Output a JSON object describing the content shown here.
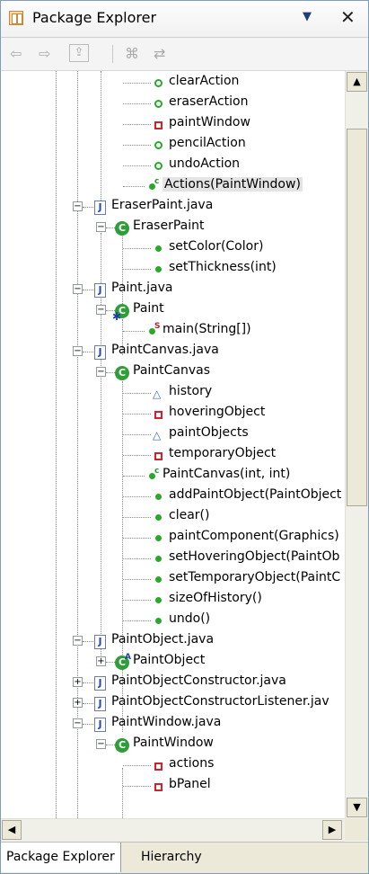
{
  "view": {
    "title": "Package Explorer",
    "menu_glyph": "▼",
    "close_glyph": "✕"
  },
  "toolbar": {
    "back_glyph": "⇦",
    "forward_glyph": "⇨",
    "up_glyph": "⇪",
    "collapse_glyph": "⌘",
    "link_glyph": "⇄"
  },
  "tree": {
    "rows": [
      {
        "label": "clearAction",
        "icon": "field-public-icon"
      },
      {
        "label": "eraserAction",
        "icon": "field-public-icon"
      },
      {
        "label": "paintWindow",
        "icon": "field-private-icon"
      },
      {
        "label": "pencilAction",
        "icon": "field-public-icon"
      },
      {
        "label": "undoAction",
        "icon": "field-public-icon"
      },
      {
        "label": "Actions(PaintWindow)",
        "icon": "constructor-icon",
        "selected": true
      },
      {
        "label": "EraserPaint.java",
        "icon": "java-file-icon"
      },
      {
        "label": "EraserPaint",
        "icon": "class-icon"
      },
      {
        "label": "setColor(Color)",
        "icon": "method-public-icon"
      },
      {
        "label": "setThickness(int)",
        "icon": "method-public-icon"
      },
      {
        "label": "Paint.java",
        "icon": "java-file-icon"
      },
      {
        "label": "Paint",
        "icon": "main-class-icon"
      },
      {
        "label": "main(String[])",
        "icon": "static-method-icon"
      },
      {
        "label": "PaintCanvas.java",
        "icon": "java-file-icon"
      },
      {
        "label": "PaintCanvas",
        "icon": "class-icon"
      },
      {
        "label": "history",
        "icon": "field-protected-icon"
      },
      {
        "label": "hoveringObject",
        "icon": "field-private-icon"
      },
      {
        "label": "paintObjects",
        "icon": "field-protected-icon"
      },
      {
        "label": "temporaryObject",
        "icon": "field-private-icon"
      },
      {
        "label": "PaintCanvas(int, int)",
        "icon": "constructor-icon"
      },
      {
        "label": "addPaintObject(PaintObject",
        "icon": "method-public-icon"
      },
      {
        "label": "clear()",
        "icon": "method-public-icon"
      },
      {
        "label": "paintComponent(Graphics)",
        "icon": "method-public-icon"
      },
      {
        "label": "setHoveringObject(PaintOb",
        "icon": "method-public-icon"
      },
      {
        "label": "setTemporaryObject(PaintC",
        "icon": "method-public-icon"
      },
      {
        "label": "sizeOfHistory()",
        "icon": "method-public-icon"
      },
      {
        "label": "undo()",
        "icon": "method-public-icon"
      },
      {
        "label": "PaintObject.java",
        "icon": "java-file-icon"
      },
      {
        "label": "PaintObject",
        "icon": "abstract-class-icon"
      },
      {
        "label": "PaintObjectConstructor.java",
        "icon": "java-file-icon"
      },
      {
        "label": "PaintObjectConstructorListener.jav",
        "icon": "java-file-icon"
      },
      {
        "label": "PaintWindow.java",
        "icon": "java-file-icon"
      },
      {
        "label": "PaintWindow",
        "icon": "class-icon"
      },
      {
        "label": "actions",
        "icon": "field-private-icon"
      },
      {
        "label": "bPanel",
        "icon": "field-private-icon"
      }
    ]
  },
  "glyphs": {
    "java_letter": "J",
    "class_letter": "C",
    "constructor_sup": "c",
    "static_sup": "S",
    "abstract_sup": "A",
    "protected_tri": "△",
    "expanded": "−",
    "collapsed": "+"
  },
  "scroll": {
    "up": "▲",
    "down": "▼",
    "left": "◀",
    "right": "▶"
  },
  "tabs": [
    {
      "label": "Package Explorer",
      "active": true
    },
    {
      "label": "Hierarchy",
      "active": false
    }
  ]
}
